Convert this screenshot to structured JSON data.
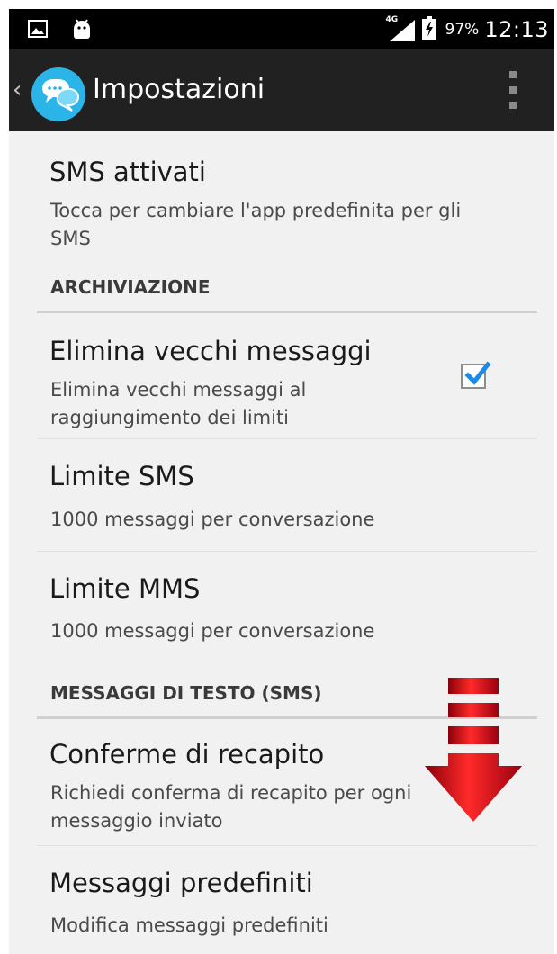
{
  "status_bar": {
    "network_type": "4G",
    "battery_percent": "97%",
    "time": "12:13",
    "icons": [
      "gallery-icon",
      "android-debug-icon",
      "signal-icon",
      "battery-charging-icon"
    ]
  },
  "action_bar": {
    "title": "Impostazioni",
    "back_glyph": "‹",
    "icons": [
      "app-logo-icon",
      "overflow-menu-icon"
    ]
  },
  "preferences": {
    "sms_enabled": {
      "title": "SMS attivati",
      "summary": "Tocca per cambiare l'app predefinita per gli SMS"
    },
    "storage_header": "ARCHIVIAZIONE",
    "delete_old": {
      "title": "Elimina vecchi messaggi",
      "summary": "Elimina vecchi messaggi al raggiungimento dei limiti",
      "checked": true
    },
    "sms_limit": {
      "title": "Limite SMS",
      "summary": "1000 messaggi per conversazione"
    },
    "mms_limit": {
      "title": "Limite MMS",
      "summary": "1000 messaggi per conversazione"
    },
    "text_messages_header": "MESSAGGI DI TESTO (SMS)",
    "delivery_reports": {
      "title": "Conferme di recapito",
      "summary": "Richiedi conferma di recapito per ogni messaggio inviato"
    },
    "quick_messages": {
      "title": "Messaggi predefiniti",
      "summary": "Modifica messaggi predefiniti"
    }
  },
  "colors": {
    "status_bar": "#000000",
    "action_bar": "#212121",
    "background": "#f1f1f1",
    "accent_checkbox": "#1e88e5",
    "arrow_red": "#d9000f"
  }
}
